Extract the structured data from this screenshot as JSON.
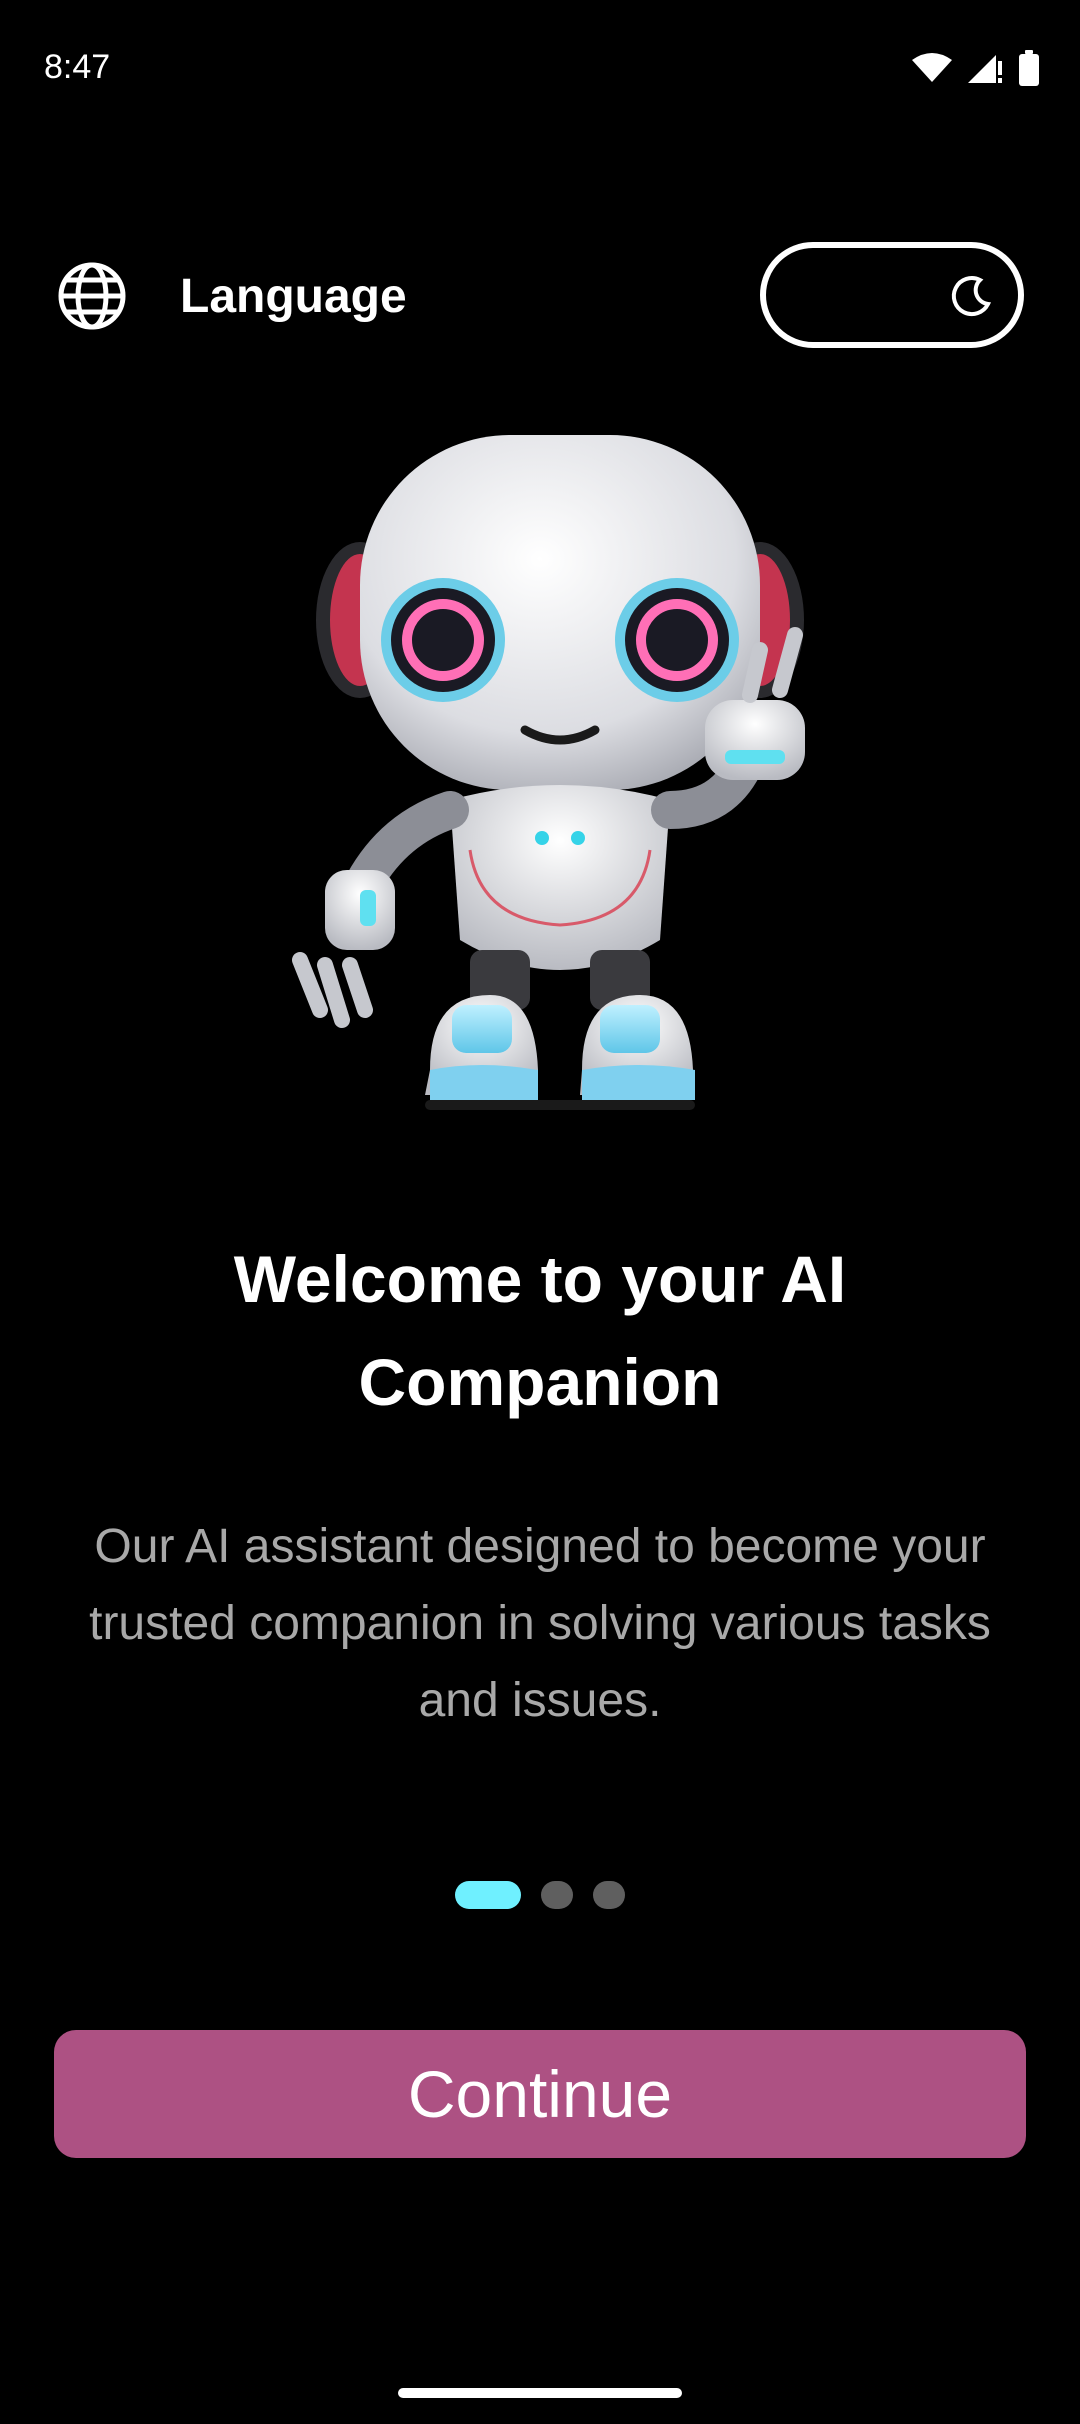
{
  "status_bar": {
    "time": "8:47"
  },
  "header": {
    "language_label": "Language"
  },
  "onboarding": {
    "title": "Welcome to your AI Companion",
    "description": "Our AI assistant designed to become your trusted companion in solving various tasks and issues.",
    "page_indicator": {
      "total": 3,
      "current": 1
    }
  },
  "actions": {
    "continue_label": "Continue"
  },
  "icons": {
    "language": "globe-icon",
    "theme": "moon-icon",
    "wifi": "wifi-icon",
    "signal": "signal-icon",
    "battery": "battery-icon"
  },
  "colors": {
    "background": "#000000",
    "accent_button": "#ad5183",
    "active_dot": "#6ff0ff",
    "inactive_dot": "#5f5f5f",
    "description_text": "#a8a8a8"
  }
}
